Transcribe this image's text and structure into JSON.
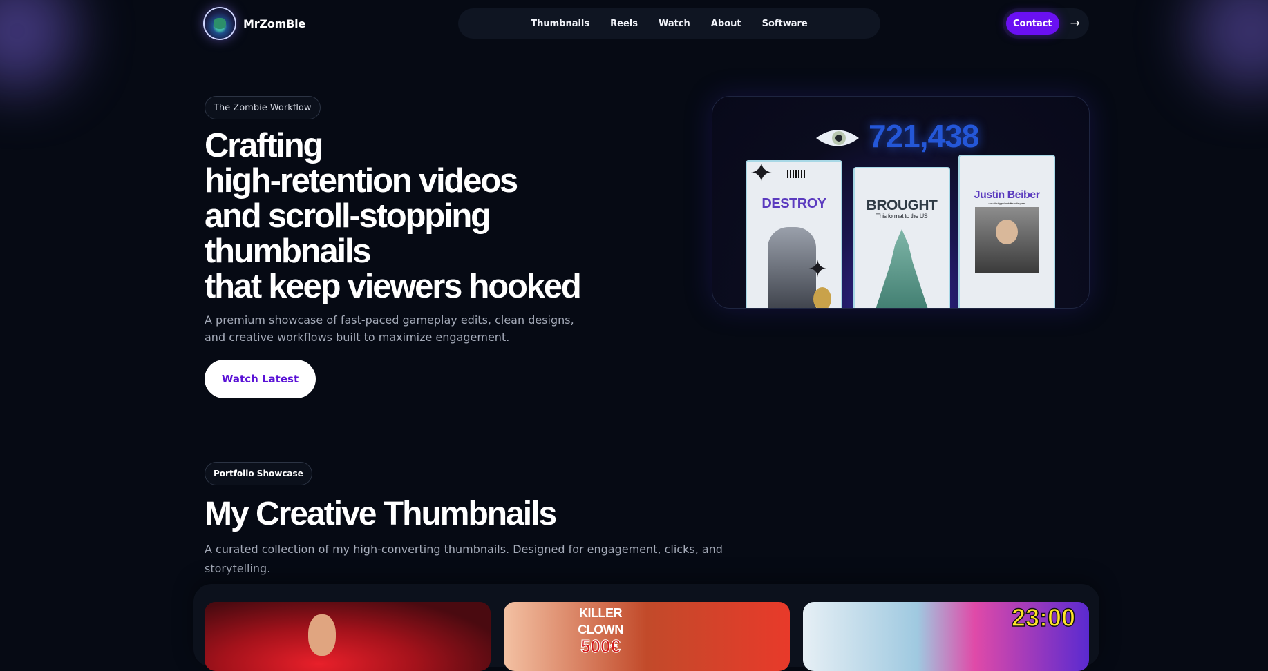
{
  "brand": {
    "name": "MrZomBie"
  },
  "nav": {
    "items": [
      "Thumbnails",
      "Reels",
      "Watch",
      "About",
      "Software"
    ]
  },
  "header": {
    "contact_label": "Contact",
    "arrow": "→"
  },
  "hero": {
    "tag": "The Zombie Workflow",
    "title_lines": [
      "Crafting",
      "high-retention videos",
      "and scroll-stopping",
      "thumbnails",
      "that keep viewers hooked"
    ],
    "description": "A premium showcase of fast-paced gameplay edits, clean designs, and creative workflows built to maximize engagement.",
    "cta_label": "Watch Latest",
    "image": {
      "view_count": "721,438",
      "card_1": {
        "headline": "DESTROY"
      },
      "card_2": {
        "headline": "BROUGHT",
        "subline": "This format to the US"
      },
      "card_3": {
        "headline": "Justin Beiber",
        "subline": "one of the biggest celebrities on the planet"
      }
    }
  },
  "portfolio": {
    "tag": "Portfolio Showcase",
    "title": "My Creative Thumbnails",
    "description": "A curated collection of my high-converting thumbnails. Designed for engagement, clicks, and storytelling.",
    "thumbnails": [
      {
        "overlay_top": "",
        "overlay_bottom": ""
      },
      {
        "overlay_top": "KILLER CLOWN",
        "overlay_bottom": "500€"
      },
      {
        "overlay_top": "23:00",
        "overlay_bottom": ""
      }
    ]
  },
  "colors": {
    "background": "#060a14",
    "accent": "#6a10f2",
    "nav_bg": "#0f1522",
    "muted_text": "#a4aab8",
    "view_count": "#2457d8"
  },
  "icons": [
    "avatar-logo",
    "arrow-right-icon",
    "eye-icon",
    "star-icon"
  ]
}
